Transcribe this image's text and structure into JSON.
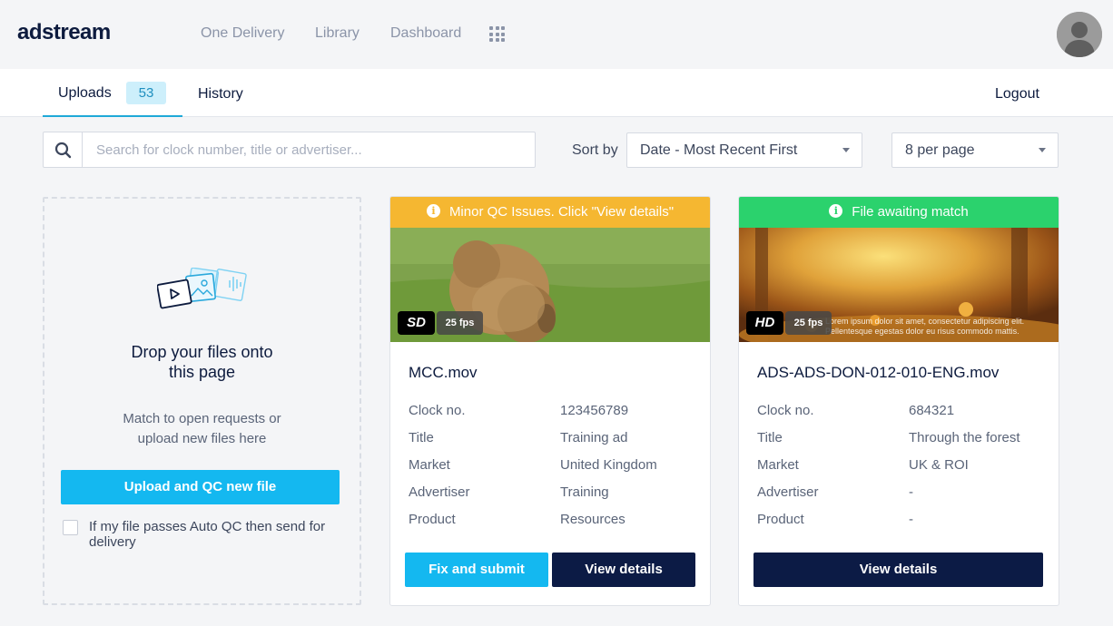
{
  "header": {
    "logo": "adstream",
    "nav": [
      "One Delivery",
      "Library",
      "Dashboard"
    ],
    "apps_icon": "grid-icon",
    "avatar_icon": "user-avatar-icon"
  },
  "tabs": {
    "uploads_label": "Uploads",
    "uploads_count": "53",
    "history_label": "History",
    "logout_label": "Logout"
  },
  "controls": {
    "search_placeholder": "Search for clock number, title or advertiser...",
    "sort_label": "Sort by",
    "sort_value": "Date - Most Recent First",
    "per_page_value": "8 per page"
  },
  "dropzone": {
    "title_line1": "Drop your files onto",
    "title_line2": "this page",
    "sub_line1": "Match to open requests or",
    "sub_line2": "upload new files here",
    "upload_button": "Upload and QC new file",
    "checkbox_label": "If my file passes Auto QC then send for delivery",
    "checkbox_checked": false
  },
  "cards": [
    {
      "banner": "Minor QC Issues. Click \"View details\"",
      "banner_color": "#f5b731",
      "quality": "SD",
      "fps": "25 fps",
      "filename": "MCC.mov",
      "fields": [
        {
          "key": "Clock no.",
          "value": "123456789"
        },
        {
          "key": "Title",
          "value": "Training ad"
        },
        {
          "key": "Market",
          "value": "United Kingdom"
        },
        {
          "key": "Advertiser",
          "value": "Training"
        },
        {
          "key": "Product",
          "value": "Resources"
        }
      ],
      "primary_button": "Fix and submit",
      "secondary_button": "View details"
    },
    {
      "banner": "File awaiting match",
      "banner_color": "#2bd26d",
      "quality": "HD",
      "fps": "25 fps",
      "subtitle_text": "Lorem ipsum dolor sit amet, consectetur adipiscing elit. Pellentesque egestas dolor eu risus commodo mattis.",
      "filename": "ADS-ADS-DON-012-010-ENG.mov",
      "fields": [
        {
          "key": "Clock no.",
          "value": "684321"
        },
        {
          "key": "Title",
          "value": "Through the forest"
        },
        {
          "key": "Market",
          "value": "UK & ROI"
        },
        {
          "key": "Advertiser",
          "value": "-"
        },
        {
          "key": "Product",
          "value": "-"
        }
      ],
      "primary_button": "View details"
    }
  ]
}
